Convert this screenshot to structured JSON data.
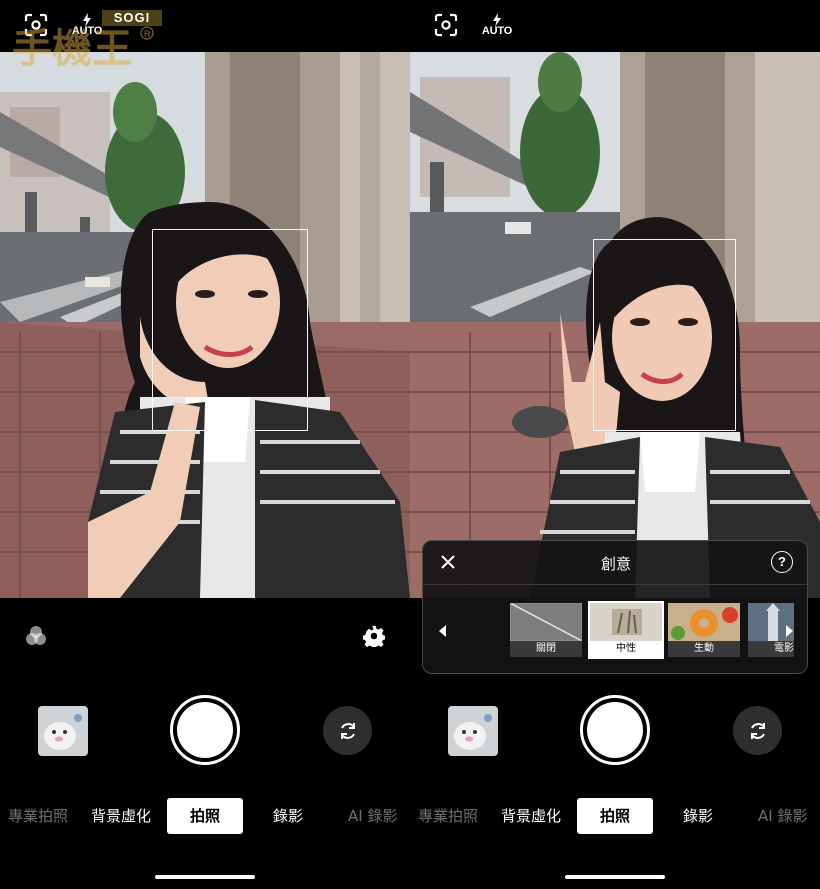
{
  "watermark": {
    "brand": "SOGI",
    "logo_script": "手機王"
  },
  "left_panel": {
    "flash_label": "AUTO",
    "modes": [
      "專業拍照",
      "背景虛化",
      "拍照",
      "錄影",
      "AI 錄影"
    ],
    "active_mode": "拍照"
  },
  "right_panel": {
    "flash_label": "AUTO",
    "creative_panel": {
      "title": "創意",
      "help_glyph": "?",
      "filters": [
        {
          "label": "關閉",
          "selected": false
        },
        {
          "label": "中性",
          "selected": true
        },
        {
          "label": "生動",
          "selected": false
        },
        {
          "label": "電影",
          "selected": false
        }
      ]
    },
    "modes": [
      "專業拍照",
      "背景虛化",
      "拍照",
      "錄影",
      "AI 錄影"
    ],
    "active_mode": "拍照"
  },
  "icons": {
    "focus": "face-focus-icon",
    "flash": "flash-auto-icon",
    "filters": "color-filters-icon",
    "settings": "gear-icon",
    "switch": "camera-switch-icon",
    "close": "close-icon",
    "help": "help-icon"
  },
  "colors": {
    "background": "#000000",
    "active_mode_bg": "#ffffff",
    "panel_border": "#4a4a4a"
  }
}
